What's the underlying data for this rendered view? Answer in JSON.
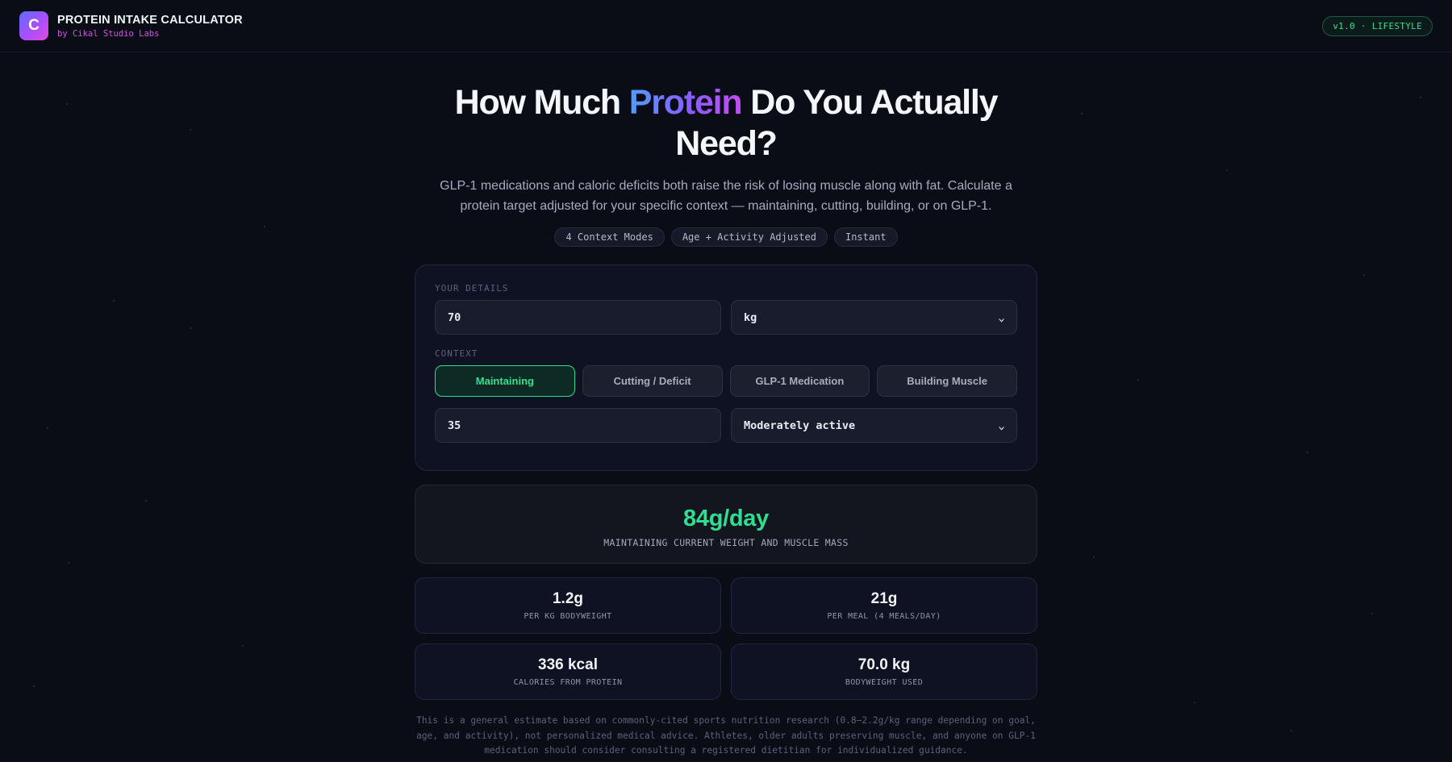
{
  "header": {
    "logo_letter": "C",
    "title": "PROTEIN INTAKE CALCULATOR",
    "subtitle": "by Cikal Studio Labs",
    "version_badge": "v1.0 · LIFESTYLE"
  },
  "hero": {
    "title_pre": "How Much ",
    "title_highlight": "Protein",
    "title_post": " Do You Actually Need?",
    "description": "GLP-1 medications and caloric deficits both raise the risk of losing muscle along with fat. Calculate a protein target adjusted for your specific context — maintaining, cutting, building, or on GLP-1.",
    "chips": [
      "4 Context Modes",
      "Age + Activity Adjusted",
      "Instant"
    ]
  },
  "form": {
    "details_label": "YOUR DETAILS",
    "weight_value": "70",
    "unit_selected": "kg",
    "context_label": "CONTEXT",
    "modes": [
      "Maintaining",
      "Cutting / Deficit",
      "GLP-1 Medication",
      "Building Muscle"
    ],
    "active_mode": "Maintaining",
    "age_value": "35",
    "activity_selected": "Moderately active"
  },
  "result": {
    "value": "84g/day",
    "description": "MAINTAINING CURRENT WEIGHT AND MUSCLE MASS"
  },
  "stats": [
    {
      "value": "1.2g",
      "label": "PER KG BODYWEIGHT"
    },
    {
      "value": "21g",
      "label": "PER MEAL (4 MEALS/DAY)"
    },
    {
      "value": "336 kcal",
      "label": "CALORIES FROM PROTEIN"
    },
    {
      "value": "70.0 kg",
      "label": "BODYWEIGHT USED"
    }
  ],
  "disclaimer": "This is a general estimate based on commonly-cited sports nutrition research (0.8–2.2g/kg range depending on goal, age, and activity), not personalized medical advice. Athletes, older adults preserving muscle, and anyone on GLP-1 medication should consider consulting a registered dietitian for individualized guidance.",
  "colors": {
    "background": "#0a0c16",
    "accent_green": "#2fdf8f",
    "brand_magenta": "#d84fe6",
    "gradient_start": "#4f9dff",
    "gradient_end": "#c44cf0"
  }
}
